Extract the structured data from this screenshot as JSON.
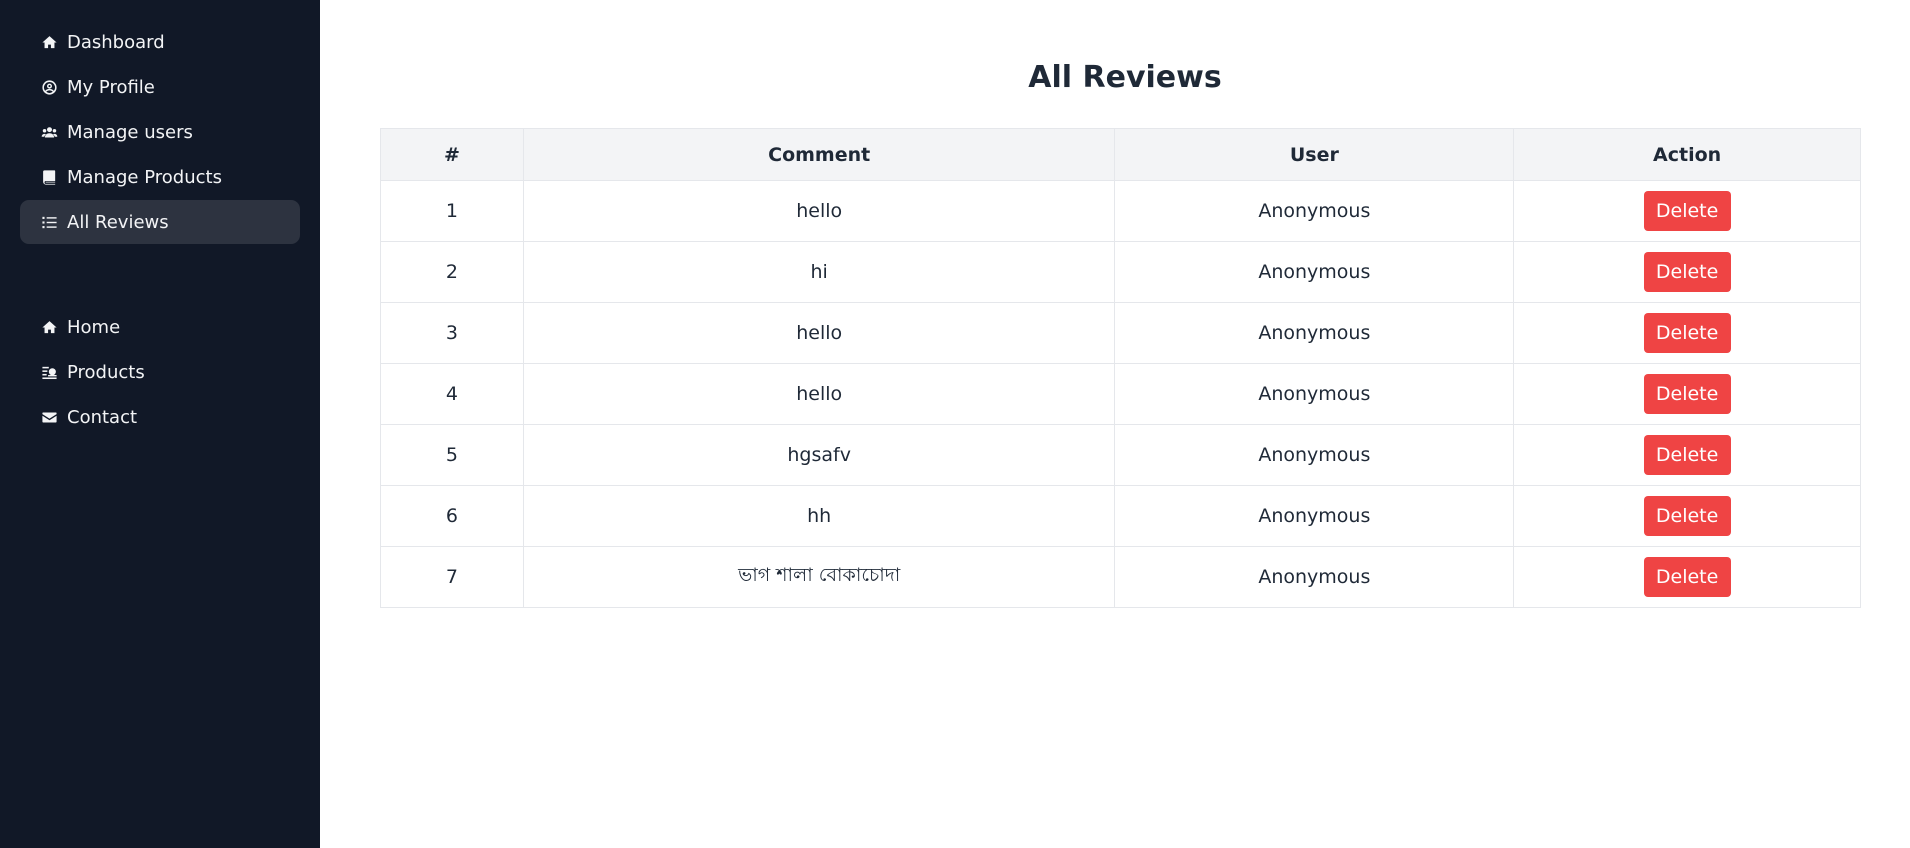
{
  "sidebar": {
    "primary": [
      {
        "label": "Dashboard",
        "icon": "home-icon"
      },
      {
        "label": "My Profile",
        "icon": "user-circle-icon"
      },
      {
        "label": "Manage users",
        "icon": "users-icon"
      },
      {
        "label": "Manage Products",
        "icon": "book-icon"
      },
      {
        "label": "All Reviews",
        "icon": "list-icon",
        "active": true
      }
    ],
    "secondary": [
      {
        "label": "Home",
        "icon": "home-icon"
      },
      {
        "label": "Products",
        "icon": "products-icon"
      },
      {
        "label": "Contact",
        "icon": "envelope-icon"
      }
    ]
  },
  "main": {
    "title": "All Reviews",
    "table": {
      "headers": [
        "#",
        "Comment",
        "User",
        "Action"
      ],
      "rows": [
        {
          "num": "1",
          "comment": "hello",
          "user": "Anonymous",
          "action": "Delete"
        },
        {
          "num": "2",
          "comment": "hi",
          "user": "Anonymous",
          "action": "Delete"
        },
        {
          "num": "3",
          "comment": "hello",
          "user": "Anonymous",
          "action": "Delete"
        },
        {
          "num": "4",
          "comment": "hello",
          "user": "Anonymous",
          "action": "Delete"
        },
        {
          "num": "5",
          "comment": "hgsafv",
          "user": "Anonymous",
          "action": "Delete"
        },
        {
          "num": "6",
          "comment": "hh",
          "user": "Anonymous",
          "action": "Delete"
        },
        {
          "num": "7",
          "comment": "ভাগ শালা বোকাচোদা",
          "user": "Anonymous",
          "action": "Delete"
        }
      ]
    }
  },
  "colors": {
    "sidebar_bg": "#111827",
    "active_item_bg": "#2d3340",
    "header_bg": "#f3f4f6",
    "delete_button": "#ef4444"
  }
}
